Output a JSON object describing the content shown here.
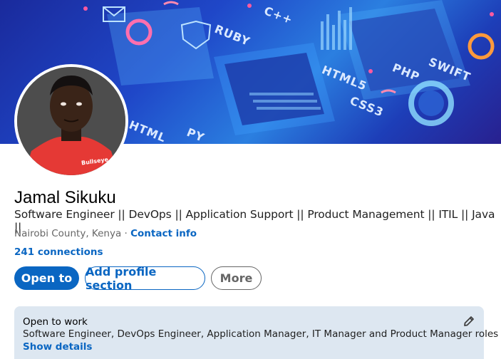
{
  "banner": {
    "words": [
      "C++",
      "RUBY",
      "HTML5",
      "CSS3",
      "PHP",
      "SWIFT",
      "HTML",
      "PY"
    ]
  },
  "profile": {
    "name": "Jamal Sikuku",
    "headline": "Software Engineer || DevOps || Application Support || Product Management || ITIL || Java ||",
    "location": "Nairobi County, Kenya",
    "separator": " · ",
    "contact_info": "Contact info",
    "connections": "241 connections",
    "avatar_shirt_text": "Bullseye"
  },
  "actions": {
    "open_to": "Open to",
    "add_profile_section": "Add profile section",
    "more": "More"
  },
  "open_to_work": {
    "title": "Open to work",
    "roles": "Software Engineer, DevOps Engineer, Application Manager, IT Manager and Product Manager roles",
    "show_details": "Show details"
  },
  "colors": {
    "accent": "#0a66c2",
    "card_bg": "#dde7f1",
    "shirt": "#e53935"
  }
}
